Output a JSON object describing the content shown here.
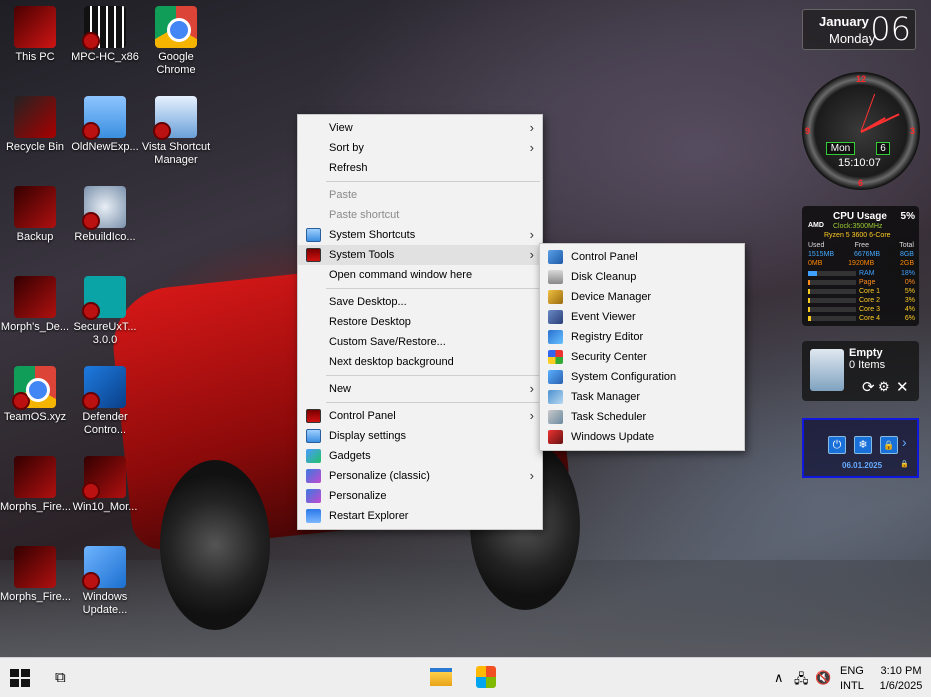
{
  "desktop": {
    "icons": [
      {
        "label": "This PC",
        "icon": "this-pc-icon"
      },
      {
        "label": "MPC-HC_x86",
        "icon": "mpc-hc-icon"
      },
      {
        "label": "Google Chrome",
        "icon": "chrome-icon"
      },
      {
        "label": "Recycle Bin",
        "icon": "recycle-bin-icon"
      },
      {
        "label": "OldNewExp...",
        "icon": "folder-icon"
      },
      {
        "label": "Vista Shortcut Manager",
        "icon": "vista-shortcut-icon"
      },
      {
        "label": "Backup",
        "icon": "backup-icon"
      },
      {
        "label": "RebuildIco...",
        "icon": "robot-icon"
      },
      {
        "label": "Morph's_De...",
        "icon": "morph-icon"
      },
      {
        "label": "SecureUxT... 3.0.0",
        "icon": "secureux-icon"
      },
      {
        "label": "TeamOS.xyz",
        "icon": "chrome-shortcut-icon"
      },
      {
        "label": "Defender Contro...",
        "icon": "defender-icon"
      },
      {
        "label": "Morphs_Fire...",
        "icon": "firewall-icon"
      },
      {
        "label": "Win10_Mor...",
        "icon": "win10-icon"
      },
      {
        "label": "Morphs_Fire...",
        "icon": "firewall-icon"
      },
      {
        "label": "Windows Update...",
        "icon": "windows-update-icon"
      }
    ]
  },
  "context_menu": {
    "items": [
      {
        "label": "View",
        "submenu": true
      },
      {
        "label": "Sort by",
        "submenu": true
      },
      {
        "label": "Refresh"
      },
      {
        "label": "Paste",
        "disabled": true
      },
      {
        "label": "Paste shortcut",
        "disabled": true
      },
      {
        "label": "System Shortcuts",
        "submenu": true,
        "icon": "display-icon"
      },
      {
        "label": "System Tools",
        "submenu": true,
        "icon": "monitor-icon"
      },
      {
        "label": "Open command window here"
      },
      {
        "label": "Save Desktop..."
      },
      {
        "label": "Restore Desktop"
      },
      {
        "label": "Custom Save/Restore..."
      },
      {
        "label": "Next desktop background"
      },
      {
        "label": "New",
        "submenu": true
      },
      {
        "label": "Control Panel",
        "submenu": true,
        "icon": "monitor-icon"
      },
      {
        "label": "Display settings",
        "icon": "display-icon"
      },
      {
        "label": "Gadgets",
        "icon": "gadgets-icon"
      },
      {
        "label": "Personalize (classic)",
        "submenu": true,
        "icon": "personalize-icon"
      },
      {
        "label": "Personalize",
        "icon": "personalize-icon"
      },
      {
        "label": "Restart Explorer",
        "icon": "restart-icon"
      }
    ],
    "arrow": "›"
  },
  "system_tools_menu": {
    "items": [
      {
        "label": "Control Panel",
        "icon": "control-panel-icon"
      },
      {
        "label": "Disk Cleanup",
        "icon": "disk-cleanup-icon"
      },
      {
        "label": "Device Manager",
        "icon": "device-manager-icon"
      },
      {
        "label": "Event Viewer",
        "icon": "event-viewer-icon"
      },
      {
        "label": "Registry Editor",
        "icon": "registry-icon"
      },
      {
        "label": "Security Center",
        "icon": "security-center-icon"
      },
      {
        "label": "System Configuration",
        "icon": "system-config-icon"
      },
      {
        "label": "Task Manager",
        "icon": "task-manager-icon"
      },
      {
        "label": "Task Scheduler",
        "icon": "task-scheduler-icon"
      },
      {
        "label": "Windows Update",
        "icon": "windows-update-icon"
      }
    ]
  },
  "calendar_gadget": {
    "month": "January",
    "weekday": "Monday",
    "day": "06"
  },
  "clock_gadget": {
    "numbers": [
      "12",
      "3",
      "6",
      "9"
    ],
    "day": "Mon",
    "date": "6",
    "time": "15:10:07"
  },
  "cpu_gadget": {
    "brand": "AMD",
    "title": "CPU Usage",
    "percent": "5%",
    "clock": "Clock:3500MHz",
    "model": "Ryzen 5 3600 6-Core",
    "mem_header": [
      "Used",
      "Free",
      "Total"
    ],
    "mem_row1": [
      "1515MB",
      "6676MB",
      "8GB"
    ],
    "mem_row2": [
      "0MB",
      "1920MB",
      "2GB"
    ],
    "meters": [
      {
        "label": "RAM",
        "value": "18%",
        "fraction": 0.18,
        "color": "#3fa0ff"
      },
      {
        "label": "Page",
        "value": "0%",
        "fraction": 0.0,
        "color": "#ff8c1a"
      },
      {
        "label": "Core 1",
        "value": "5%",
        "fraction": 0.05,
        "color": "#ffcc22"
      },
      {
        "label": "Core 2",
        "value": "3%",
        "fraction": 0.03,
        "color": "#ffcc22"
      },
      {
        "label": "Core 3",
        "value": "4%",
        "fraction": 0.04,
        "color": "#ffcc22"
      },
      {
        "label": "Core 4",
        "value": "6%",
        "fraction": 0.06,
        "color": "#ffcc22"
      }
    ]
  },
  "recycle_gadget": {
    "title": "Empty",
    "items": "0 Items",
    "refresh": "⟳",
    "settings": "⚙",
    "close": "✕"
  },
  "lock_gadget": {
    "date": "06.01.2025",
    "power": "⏻",
    "gear": "❄",
    "lock": "🔒",
    "next": "›",
    "small_lock": "🔒"
  },
  "taskbar": {
    "start_icon": "windows-start-icon",
    "taskview_glyph": "⧉",
    "tray_chevron": "∧",
    "tray_network": "🖧",
    "tray_sound": "🔇",
    "language": [
      "ENG",
      "INTL"
    ],
    "time": "3:10 PM",
    "date": "1/6/2025"
  },
  "colors": {
    "menu_bg": "#f2f2f2",
    "menu_highlight": "#e1e1e1",
    "taskbar_bg": "#eeeeee",
    "lock_border": "#1018e0"
  }
}
